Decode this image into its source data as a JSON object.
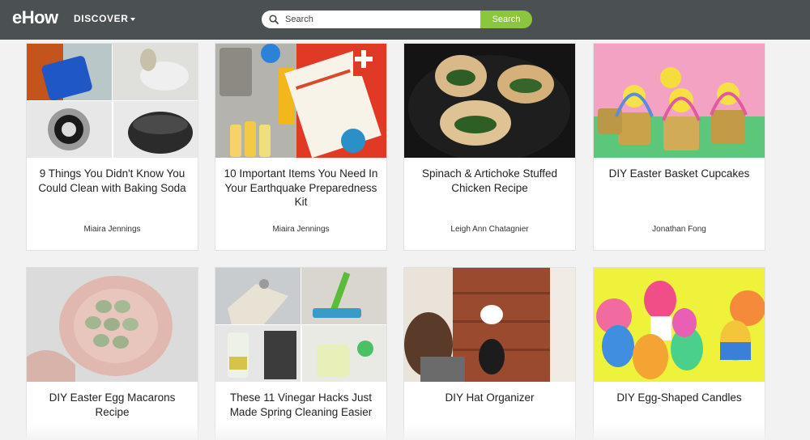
{
  "header": {
    "logo": "eHow",
    "discover_label": "DISCOVER",
    "search_placeholder": "Search",
    "search_button": "Search",
    "colors": {
      "bar": "#4b5152",
      "accent": "#8cc63f"
    }
  },
  "cards": [
    {
      "title": "9 Things You Didn't Know You Could Clean with Baking Soda",
      "author": "Miaira Jennings"
    },
    {
      "title": "10 Important Items You Need In Your Earthquake Preparedness Kit",
      "author": "Miaira Jennings"
    },
    {
      "title": "Spinach & Artichoke Stuffed Chicken Recipe",
      "author": "Leigh Ann Chatagnier"
    },
    {
      "title": "DIY Easter Basket Cupcakes",
      "author": "Jonathan Fong"
    },
    {
      "title": "DIY Easter Egg Macarons Recipe",
      "author": ""
    },
    {
      "title": "These 11 Vinegar Hacks Just Made Spring Cleaning Easier",
      "author": ""
    },
    {
      "title": "DIY Hat Organizer",
      "author": ""
    },
    {
      "title": "DIY Egg-Shaped Candles",
      "author": ""
    }
  ]
}
